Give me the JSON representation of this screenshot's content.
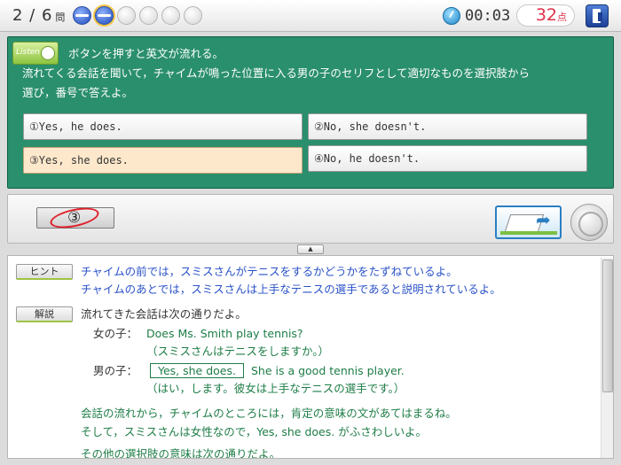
{
  "header": {
    "question_current": "2",
    "question_sep": " / ",
    "question_total": "6",
    "question_unit": "問",
    "progress": [
      "done",
      "current",
      "empty",
      "empty",
      "empty",
      "empty"
    ],
    "timer": "00:03",
    "score": "32",
    "score_unit": "点",
    "icons": {
      "timer": "stopwatch-icon",
      "exit": "exit-door-icon"
    }
  },
  "question": {
    "listen_label": "Listen",
    "instruction_line1": "ボタンを押すと英文が流れる。",
    "instruction_line2": "流れてくる会話を聞いて，チャイムが鳴った位置に入る男の子のセリフとして適切なものを選択肢から",
    "instruction_line3": "選び，番号で答えよ。",
    "options": [
      {
        "label": "①Yes, he does."
      },
      {
        "label": "②No, she doesn't."
      },
      {
        "label": "③Yes, she does.",
        "selected": true
      },
      {
        "label": "④No, he doesn't."
      }
    ]
  },
  "answer": {
    "value": "③",
    "result": "correct",
    "colors": {
      "mark": "#e0202a",
      "accent": "#2b7fc2"
    },
    "toggle_symbol": "▲"
  },
  "explanation": {
    "hint_label": "ヒント",
    "hint_line1": "チャイムの前では，スミスさんがテニスをするかどうかをたずねているよ。",
    "hint_line2": "チャイムのあとでは，スミスさんは上手なテニスの選手であると説明されているよ。",
    "explain_label": "解説",
    "intro": "流れてきた会話は次の通りだよ。",
    "girl_label": "女の子：",
    "girl_line": "Does Ms. Smith play tennis?",
    "girl_translation": "（スミスさんはテニスをしますか。）",
    "boy_label": "男の子：",
    "boy_answer": "Yes, she does.",
    "boy_line": "She is a good tennis player.",
    "boy_translation": "（はい，します。彼女は上手なテニスの選手です。）",
    "summary1": "会話の流れから，チャイムのところには，肯定の意味の文があてはまるね。",
    "summary2": "そして，スミスさんは女性なので，Yes, she does. がふさわしいよ。",
    "summary3": "その他の選択肢の意味は次の通りだよ。"
  }
}
